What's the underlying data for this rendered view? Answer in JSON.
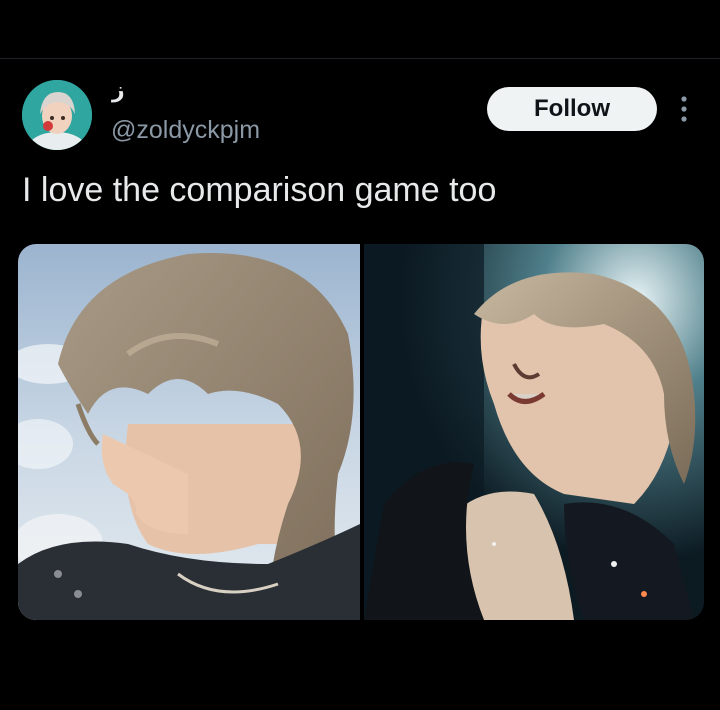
{
  "post": {
    "author": {
      "display_name": "ز",
      "handle": "@zoldyckpjm"
    },
    "follow_label": "Follow",
    "more_icon": "more-vertical-icon",
    "text": "I love the comparison game too",
    "media": [
      {
        "description_icon": "photo-left"
      },
      {
        "description_icon": "photo-right"
      }
    ]
  },
  "colors": {
    "background": "#000000",
    "text_primary": "#e7e9ea",
    "text_secondary": "#8b98a5",
    "follow_bg": "#eff3f4",
    "follow_text": "#0f1419"
  }
}
